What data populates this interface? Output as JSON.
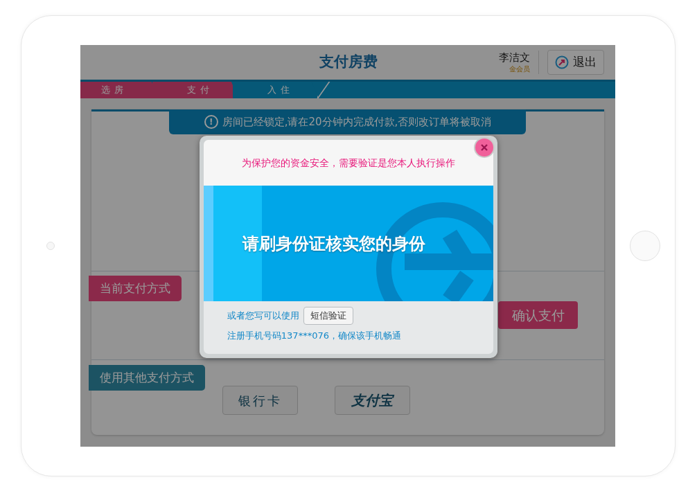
{
  "header": {
    "title": "支付房费",
    "user": {
      "name": "李洁文",
      "level": "金会员"
    },
    "logout_button": "退出"
  },
  "steps": [
    {
      "label": "选房",
      "completed": true
    },
    {
      "label": "支付",
      "completed": true
    },
    {
      "label": "入住",
      "completed": false
    }
  ],
  "notice_icon": "!",
  "notice": "房间已经锁定,请在20分钟内完成付款,否则改订单将被取消",
  "current_payment": {
    "tag": "当前支付方式",
    "confirm_button": "确认支付"
  },
  "other_payment": {
    "tag": "使用其他支付方式",
    "options": [
      {
        "kind": "text",
        "label": "银行卡"
      },
      {
        "kind": "logo",
        "label": "支付宝"
      }
    ]
  },
  "dialog": {
    "warning": "为保护您的资金安全，需要验证是您本人执行操作",
    "prompt": "请刷身份证核实您的身份",
    "alternative": "或者您写可以使用",
    "sms_button": "短信验证",
    "phone_note": "注册手机号码137***076，确保该手机畅通"
  }
}
